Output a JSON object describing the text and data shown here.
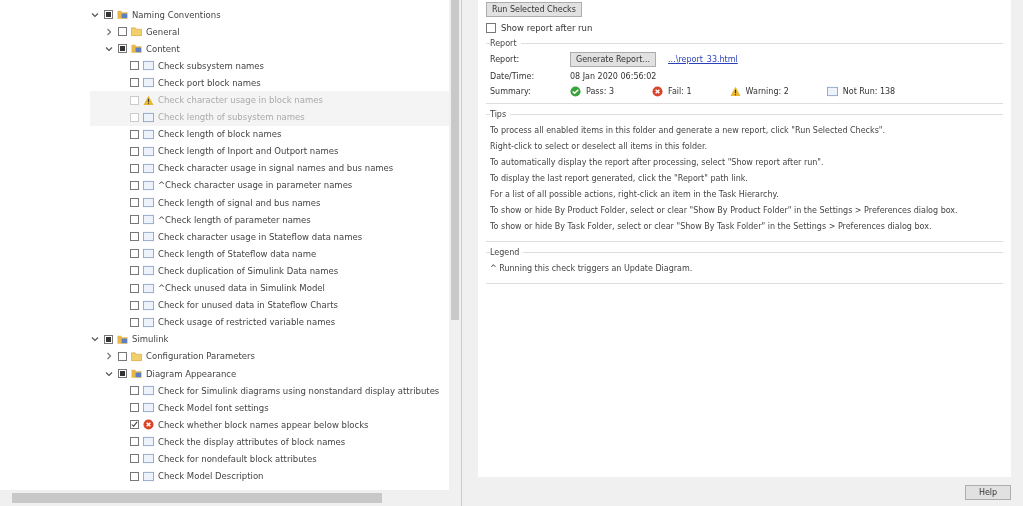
{
  "tree": [
    {
      "kind": "folder",
      "label": "Naming Conventions",
      "expanded": true,
      "mixed": true,
      "children": [
        {
          "kind": "folder",
          "label": "General",
          "expanded": false,
          "mixed": false
        },
        {
          "kind": "folder",
          "label": "Content",
          "expanded": true,
          "mixed": true,
          "children": [
            {
              "kind": "pending",
              "label": "Check subsystem names",
              "checked": false,
              "disabled": false
            },
            {
              "kind": "pending",
              "label": "Check port block names",
              "checked": false,
              "disabled": false
            },
            {
              "kind": "warning",
              "label": "Check character usage in block names",
              "checked": false,
              "disabled": true
            },
            {
              "kind": "pending",
              "label": "Check length of subsystem names",
              "checked": false,
              "disabled": true
            },
            {
              "kind": "pending",
              "label": "Check length of block names",
              "checked": false,
              "disabled": false
            },
            {
              "kind": "pending",
              "label": "Check length of Inport and Outport names",
              "checked": false,
              "disabled": false
            },
            {
              "kind": "pending",
              "label": "Check character usage in signal names and bus names",
              "checked": false,
              "disabled": false
            },
            {
              "kind": "pending",
              "label": "^Check character usage in parameter names",
              "checked": false,
              "disabled": false
            },
            {
              "kind": "pending",
              "label": "Check length of signal and bus names",
              "checked": false,
              "disabled": false
            },
            {
              "kind": "pending",
              "label": "^Check length of parameter names",
              "checked": false,
              "disabled": false
            },
            {
              "kind": "pending",
              "label": "Check character usage in Stateflow data names",
              "checked": false,
              "disabled": false
            },
            {
              "kind": "pending",
              "label": "Check length of Stateflow data name",
              "checked": false,
              "disabled": false
            },
            {
              "kind": "pending",
              "label": "Check duplication of Simulink Data names",
              "checked": false,
              "disabled": false
            },
            {
              "kind": "pending",
              "label": "^Check unused data in Simulink Model",
              "checked": false,
              "disabled": false
            },
            {
              "kind": "pending",
              "label": "Check for unused data in Stateflow Charts",
              "checked": false,
              "disabled": false
            },
            {
              "kind": "pending",
              "label": "Check usage of restricted variable names",
              "checked": false,
              "disabled": false
            }
          ]
        }
      ]
    },
    {
      "kind": "folder",
      "label": "Simulink",
      "expanded": true,
      "mixed": true,
      "children": [
        {
          "kind": "folder",
          "label": "Configuration Parameters",
          "expanded": false,
          "mixed": false
        },
        {
          "kind": "folder",
          "label": "Diagram Appearance",
          "expanded": true,
          "mixed": true,
          "children": [
            {
              "kind": "pending",
              "label": "Check for Simulink diagrams using nonstandard display attributes",
              "checked": false,
              "disabled": false
            },
            {
              "kind": "pending",
              "label": "Check Model font settings",
              "checked": false,
              "disabled": false
            },
            {
              "kind": "failed",
              "label": "Check whether block names appear below blocks",
              "checked": true,
              "disabled": false
            },
            {
              "kind": "pending",
              "label": "Check the display attributes of block names",
              "checked": false,
              "disabled": false
            },
            {
              "kind": "pending",
              "label": "Check for nondefault block attributes",
              "checked": false,
              "disabled": false
            },
            {
              "kind": "pending",
              "label": "Check Model Description",
              "checked": false,
              "disabled": false
            }
          ]
        }
      ]
    }
  ],
  "run_button": "Run Selected Checks",
  "show_report": {
    "label": "Show report after run",
    "checked": false
  },
  "report": {
    "title": "Report",
    "rows": [
      {
        "kind": "report",
        "label": "Report:",
        "button": "Generate Report...",
        "link": "...\\report_33.html"
      },
      {
        "kind": "text",
        "label": "Date/Time:",
        "value": "08 Jan 2020 06:56:02"
      },
      {
        "kind": "summary",
        "label": "Summary:",
        "items": [
          {
            "kind": "passed",
            "text": "Pass: 3"
          },
          {
            "kind": "failed",
            "text": "Fail: 1"
          },
          {
            "kind": "warning",
            "text": "Warning: 2"
          },
          {
            "kind": "pending",
            "text": "Not Run: 138"
          }
        ]
      }
    ]
  },
  "tips": {
    "title": "Tips",
    "lines": [
      "To process all enabled items in this folder and generate a new report, click \"Run Selected Checks\".",
      "Right-click to select or deselect all items in this folder.",
      "To automatically display the report after processing, select \"Show report after run\".",
      "To display the last report generated, click the \"Report\" path link.",
      "For a list of all possible actions, right-click an item in the Task Hierarchy.",
      "To show or hide By Product Folder, select or clear \"Show By Product Folder\" in the Settings > Preferences dialog box.",
      "To show or hide By Task Folder, select or clear \"Show By Task Folder\" in the Settings > Preferences dialog box."
    ]
  },
  "legend": {
    "title": "Legend",
    "lines": [
      "^ Running this check triggers an Update Diagram."
    ]
  },
  "help_button": "Help"
}
